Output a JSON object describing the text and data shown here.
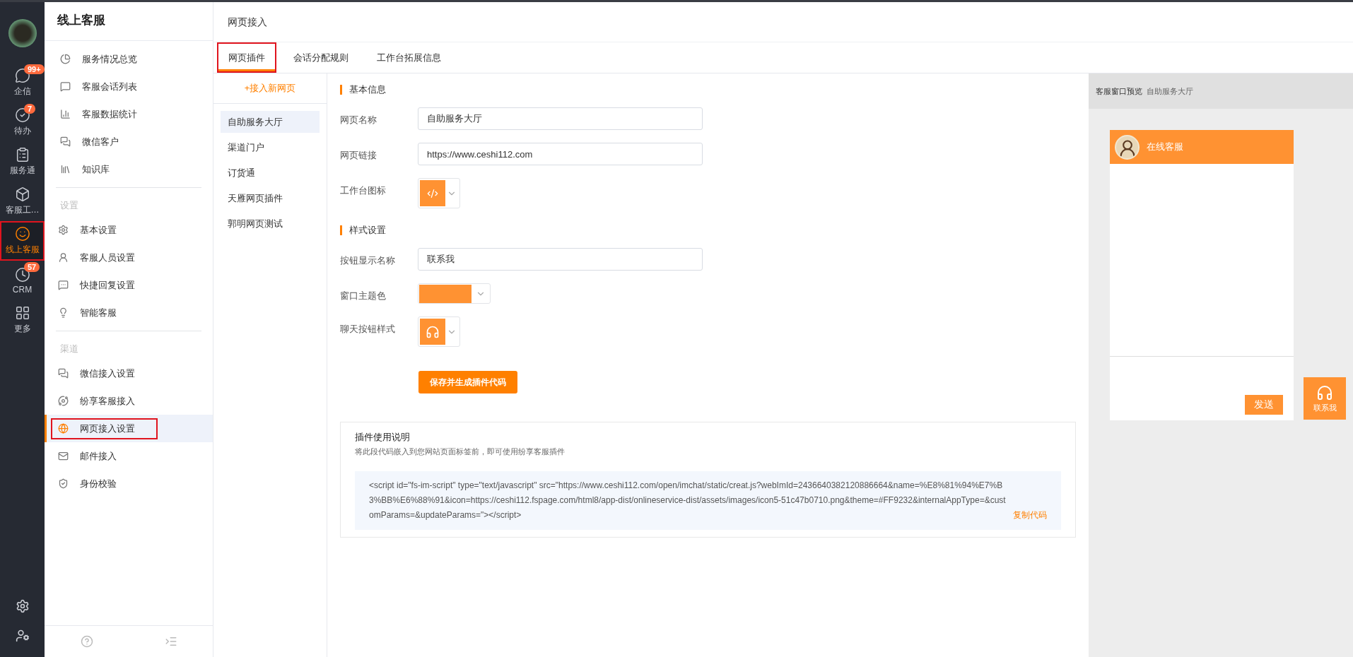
{
  "rail": {
    "items": [
      {
        "label": "企信",
        "badge": "99+",
        "selected": false
      },
      {
        "label": "待办",
        "badge": "7",
        "selected": false
      },
      {
        "label": "服务通",
        "selected": false
      },
      {
        "label": "客服工…",
        "selected": false
      },
      {
        "label": "线上客服",
        "selected": true
      },
      {
        "label": "CRM",
        "badge": "57",
        "selected": false
      },
      {
        "label": "更多",
        "selected": false
      }
    ]
  },
  "sidebar": {
    "title": "线上客服",
    "groups": [
      {
        "items": [
          {
            "label": "服务情况总览",
            "selected": false
          },
          {
            "label": "客服会话列表",
            "selected": false
          },
          {
            "label": "客服数据统计",
            "selected": false
          },
          {
            "label": "微信客户",
            "selected": false
          },
          {
            "label": "知识库",
            "selected": false
          }
        ]
      },
      {
        "title": "设置",
        "items": [
          {
            "label": "基本设置",
            "selected": false
          },
          {
            "label": "客服人员设置",
            "selected": false
          },
          {
            "label": "快捷回复设置",
            "selected": false
          },
          {
            "label": "智能客服",
            "selected": false
          }
        ]
      },
      {
        "title": "渠道",
        "items": [
          {
            "label": "微信接入设置",
            "selected": false
          },
          {
            "label": "纷享客服接入",
            "selected": false
          },
          {
            "label": "网页接入设置",
            "selected": true
          },
          {
            "label": "邮件接入",
            "selected": false
          },
          {
            "label": "身份校验",
            "selected": false
          }
        ]
      }
    ]
  },
  "page": {
    "title": "网页接入"
  },
  "tabs": [
    {
      "label": "网页插件",
      "selected": true
    },
    {
      "label": "会话分配规则",
      "selected": false
    },
    {
      "label": "工作台拓展信息",
      "selected": false
    }
  ],
  "pages": {
    "add": "+接入新网页",
    "items": [
      {
        "label": "自助服务大厅",
        "selected": true
      },
      {
        "label": "渠道门户",
        "selected": false
      },
      {
        "label": "订货通",
        "selected": false
      },
      {
        "label": "天雁网页插件",
        "selected": false
      },
      {
        "label": "郭明网页测试",
        "selected": false
      }
    ]
  },
  "form": {
    "sections": [
      {
        "title": "基本信息",
        "fields": [
          {
            "kind": "text",
            "label": "网页名称",
            "value": "自助服务大厅"
          },
          {
            "kind": "icon",
            "label": "网页链接",
            "value": "https://www.ceshi112.com"
          }
        ]
      },
      {
        "title": "样式设置",
        "fields": [
          {
            "kind": "text",
            "label": "按钮显示名称",
            "value": "联系我"
          },
          {
            "kind": "color",
            "label": "窗口主题色",
            "color": "#ff9232"
          },
          {
            "kind": "chat",
            "label": "聊天按钮样式"
          }
        ]
      }
    ],
    "workbench_icon_label": "工作台图标",
    "save": "保存并生成插件代码"
  },
  "guide": {
    "title": "插件使用说明",
    "description": "将此段代码嵌入到您网站页面标签前，即可使用纷享客服插件",
    "code": "<script id=\"fs-im-script\" type=\"text/javascript\" src=\"https://www.ceshi112.com/open/imchat/static/creat.js?webImId=2436640382120886664&name=%E8%81%94%E7%B3%BB%E6%88%91&icon=https://ceshi112.fspage.com/html8/app-dist/onlineservice-dist/assets/images/icon5-51c47b0710.png&theme=#FF9232&internalAppType=&customParams=&updateParams=\"></script>",
    "copy": "复制代码"
  },
  "preview": {
    "label": "客服窗口预览",
    "name": "自助服务大厅",
    "chat_title": "在线客服",
    "send": "发送",
    "float_button": "联系我"
  }
}
